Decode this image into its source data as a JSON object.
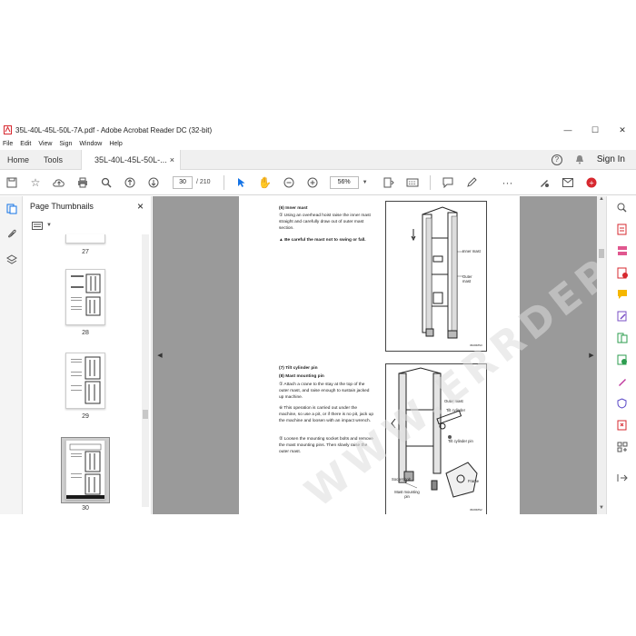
{
  "window": {
    "title": "35L-40L-45L-50L-7A.pdf - Adobe Acrobat Reader DC (32-bit)",
    "minimize": "—",
    "maximize": "☐",
    "close": "✕"
  },
  "menu": [
    "File",
    "Edit",
    "View",
    "Sign",
    "Window",
    "Help"
  ],
  "tabs": {
    "home": "Home",
    "tools": "Tools",
    "document": "35L-40L-45L-50L-...",
    "document_close": "×",
    "help_icon": "?",
    "sign_in": "Sign In"
  },
  "toolbar": {
    "current_page": "30",
    "page_total": "/  210",
    "zoom": "56%"
  },
  "thumbnails": {
    "title": "Page Thumbnails",
    "close": "×",
    "pages": [
      "27",
      "28",
      "29",
      "30"
    ]
  },
  "page": {
    "s1_heading": "(6) Inner mast",
    "s1_step1": "①  Using an overhead hoist raise the inner mast straight and carefully draw out of outer mast section.",
    "s1_warning": "▲ Be careful the mast not to swing or fall.",
    "fig1_label1": "Inner mast",
    "fig1_label2": "Outer mast",
    "fig1_code": "3620IMS3",
    "s2_heading": "(7) Tilt cylinder pin",
    "s2_heading2": "(8) Mast mounting pin",
    "s2_step1": "①  Attach a crane to the stay at the top of the outer mast, and raise enough to sustain jacked up machine.",
    "s2_note": "※  This operation is carried out under the machine, so use a pit, or if there is no pit, jack up the machine and loosen with an impact wrench.",
    "s2_step2": "②  Loosen the mounting socket bolts and remove the mast mounting pins. Then slowly raise the outer mast.",
    "fig2_label1": "Outer mast",
    "fig2_label2": "Tilt cylinder",
    "fig2_label3": "Tilt cylinder pin",
    "fig2_label4": "Socket bolt",
    "fig2_label5": "Mast mounting pin",
    "fig2_label6": "Frame",
    "fig2_code": "3620IMS2"
  },
  "watermark": "WWW.ERRDEPS.COM",
  "colors": {
    "accent": "#1473e6",
    "pdf_red": "#d7282f"
  }
}
